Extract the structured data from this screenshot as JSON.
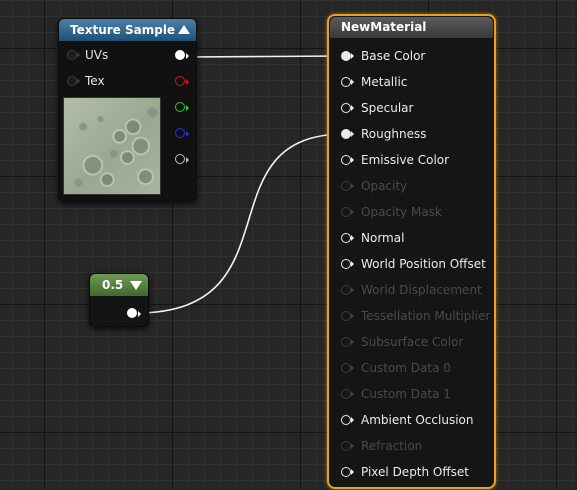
{
  "texture_sample_node": {
    "title": "Texture Sample",
    "inputs": [
      {
        "label": "UVs"
      },
      {
        "label": "Tex"
      }
    ],
    "output_pin_colors": [
      "#ffffff",
      "#d11a1a",
      "#2ad12a",
      "#2a35d8",
      "#bfbfbf"
    ],
    "thumbnail": "texture-preview"
  },
  "constant_node": {
    "value": "0.5",
    "color": "#5b8b44"
  },
  "material_node": {
    "title": "NewMaterial",
    "border_color": "#e8a319",
    "pins": [
      {
        "label": "Base Color",
        "active": true,
        "connected": true
      },
      {
        "label": "Metallic",
        "active": true,
        "connected": false
      },
      {
        "label": "Specular",
        "active": true,
        "connected": false
      },
      {
        "label": "Roughness",
        "active": true,
        "connected": true
      },
      {
        "label": "Emissive Color",
        "active": true,
        "connected": false
      },
      {
        "label": "Opacity",
        "active": false,
        "connected": false
      },
      {
        "label": "Opacity Mask",
        "active": false,
        "connected": false
      },
      {
        "label": "Normal",
        "active": true,
        "connected": false
      },
      {
        "label": "World Position Offset",
        "active": true,
        "connected": false
      },
      {
        "label": "World Displacement",
        "active": false,
        "connected": false
      },
      {
        "label": "Tessellation Multiplier",
        "active": false,
        "connected": false
      },
      {
        "label": "Subsurface Color",
        "active": false,
        "connected": false
      },
      {
        "label": "Custom Data 0",
        "active": false,
        "connected": false
      },
      {
        "label": "Custom Data 1",
        "active": false,
        "connected": false
      },
      {
        "label": "Ambient Occlusion",
        "active": true,
        "connected": false
      },
      {
        "label": "Refraction",
        "active": false,
        "connected": false
      },
      {
        "label": "Pixel Depth Offset",
        "active": true,
        "connected": false
      }
    ]
  },
  "connections": [
    {
      "from": "Texture Sample RGB",
      "to": "Base Color"
    },
    {
      "from": "0.5",
      "to": "Roughness"
    }
  ]
}
